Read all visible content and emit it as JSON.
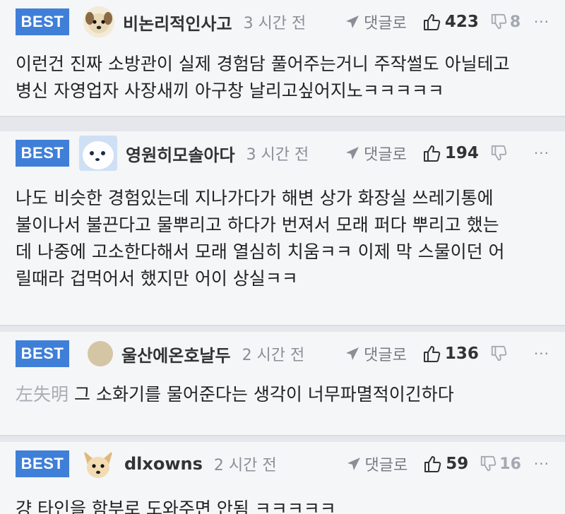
{
  "comments": [
    {
      "badge": "BEST",
      "nickname": "비논리적인사고",
      "time": "3 시간 전",
      "reply_label": "댓글로",
      "likes": "423",
      "dislikes": "8",
      "more": "···",
      "lines": [
        "이런건 진짜 소방관이 실제 경험담 풀어주는거니 주작썰도 아닐테고",
        "병신 자영업자 사장새끼 아구창 날리고싶어지노ㅋㅋㅋㅋㅋ"
      ],
      "avatar": "dog-face-icon"
    },
    {
      "badge": "BEST",
      "nickname": "영원히모솔아다",
      "time": "3 시간 전",
      "reply_label": "댓글로",
      "likes": "194",
      "dislikes": "",
      "more": "···",
      "lines": [
        "나도 비슷한 경험있는데 지나가다가 해변 상가 화장실 쓰레기통에",
        "불이나서 불끈다고 물뿌리고 하다가 번져서 모래 퍼다 뿌리고 했는",
        "데 나중에 고소한다해서 모래 열심히 치움ㅋㅋ 이제 막 스물이던 어",
        "릴때라 겁먹어서 했지만 어이 상실ㅋㅋ"
      ],
      "avatar": "seal-face-icon"
    },
    {
      "badge": "BEST",
      "nickname": "울산에온호날두",
      "time": "2 시간 전",
      "reply_label": "댓글로",
      "likes": "136",
      "dislikes": "",
      "more": "···",
      "prefix": "左失明",
      "lines": [
        "그 소화기를 물어준다는 생각이 너무파멸적이긴하다"
      ],
      "avatar": "default-avatar-icon"
    },
    {
      "badge": "BEST",
      "nickname": "dlxowns",
      "time": "2 시간 전",
      "reply_label": "댓글로",
      "likes": "59",
      "dislikes": "16",
      "more": "···",
      "lines": [
        "걍 타인을 함부로 도와주면 안됨 ㅋㅋㅋㅋㅋ"
      ],
      "avatar": "chihuahua-face-icon"
    }
  ],
  "colors": {
    "badge": "#3f7fd8",
    "muted": "#8a8e96",
    "text": "#222222"
  }
}
